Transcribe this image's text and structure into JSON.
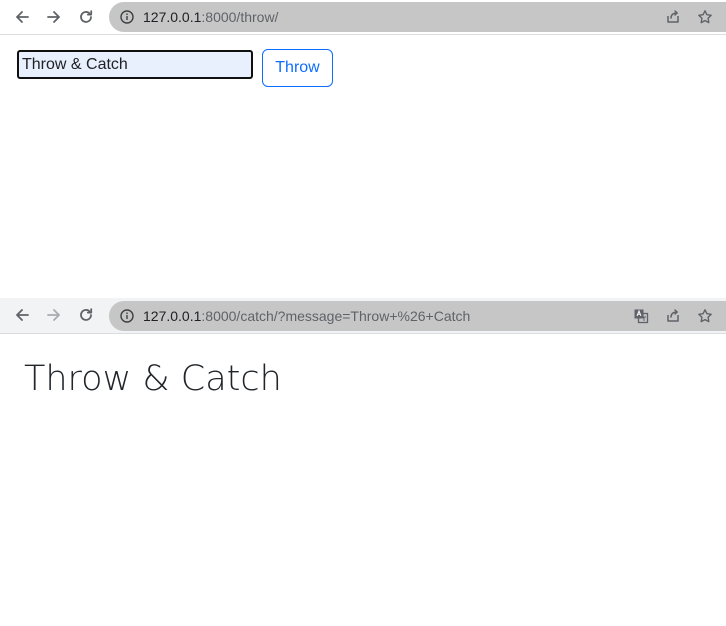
{
  "throw_window": {
    "url_host": "127.0.0.1",
    "url_path": ":8000/throw/",
    "icons": {
      "back": "arrow-left-icon",
      "forward": "arrow-right-icon",
      "reload": "reload-icon",
      "info": "info-icon",
      "share": "share-icon",
      "bookmark": "star-icon"
    },
    "message_input_value": "Throw & Catch",
    "throw_button_label": "Throw"
  },
  "catch_window": {
    "url_host": "127.0.0.1",
    "url_path": ":8000/catch/?message=Throw+%26+Catch",
    "icons": {
      "back": "arrow-left-icon",
      "forward": "arrow-right-icon",
      "reload": "reload-icon",
      "info": "info-icon",
      "translate": "translate-icon",
      "share": "share-icon",
      "bookmark": "star-icon"
    },
    "heading": "Throw & Catch"
  },
  "colors": {
    "toolbar_bg": "#f1f3f4",
    "omnibox_bg": "#c6c6c6",
    "button_accent": "#0d6efd",
    "input_bg": "#e8f0fe",
    "heading_text": "#212529"
  }
}
